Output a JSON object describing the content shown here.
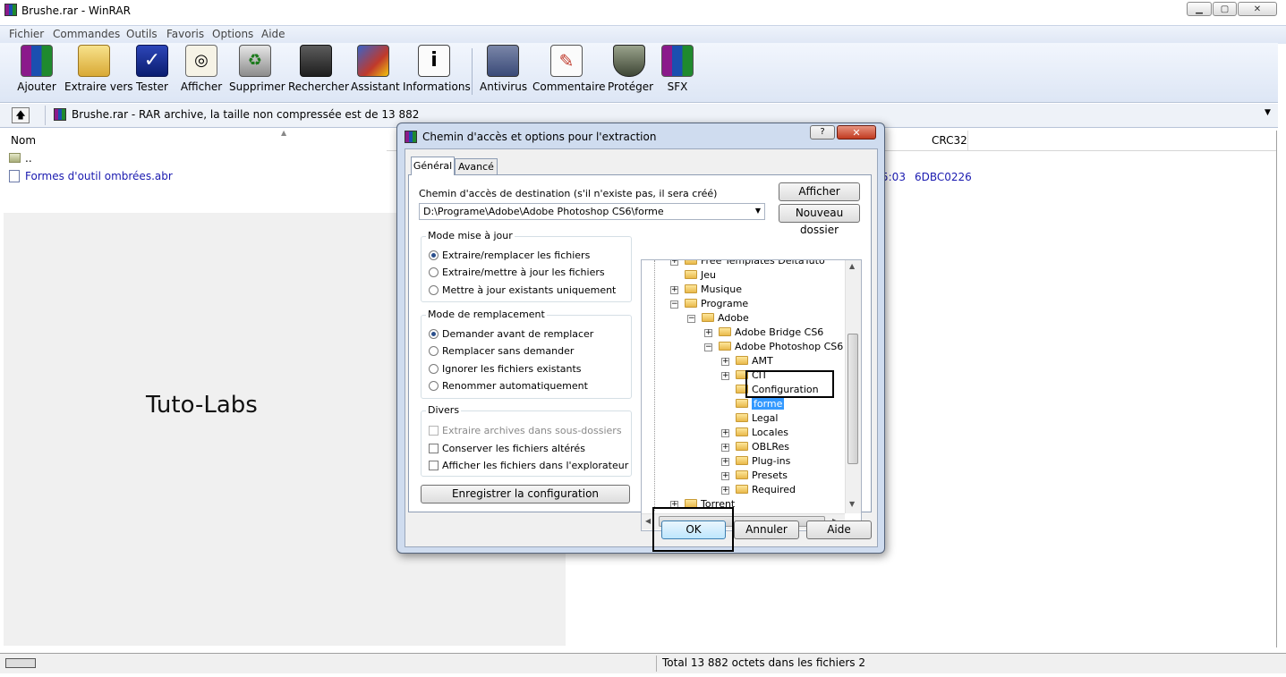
{
  "window": {
    "title": "Brushe.rar - WinRAR",
    "menu": [
      "Fichier",
      "Commandes",
      "Outils",
      "Favoris",
      "Options",
      "Aide"
    ],
    "toolbar": [
      "Ajouter",
      "Extraire vers",
      "Tester",
      "Afficher",
      "Supprimer",
      "Rechercher",
      "Assistant",
      "Informations",
      "Antivirus",
      "Commentaire",
      "Protéger",
      "SFX"
    ],
    "address": "Brushe.rar - RAR archive, la taille non compressée est de 13 882",
    "columns": {
      "name": "Nom",
      "crc": "CRC32"
    },
    "files": [
      {
        "name": "..",
        "time": "",
        "crc": ""
      },
      {
        "name": "Formes d'outil ombrées.abr",
        "time": "5:03",
        "crc": "6DBC0226"
      }
    ],
    "watermark": "Tuto-Labs",
    "status": "Total 13 882 octets dans les fichiers 2"
  },
  "dialog": {
    "title": "Chemin d'accès et options pour l'extraction",
    "help_glyph": "?",
    "close_glyph": "✕",
    "tabs": [
      "Général",
      "Avancé"
    ],
    "dest_label": "Chemin d'accès de destination (s'il n'existe pas, il sera créé)",
    "dest_value": "D:\\Programe\\Adobe\\Adobe Photoshop CS6\\forme",
    "btn_afficher": "Afficher",
    "btn_nouveau": "Nouveau dossier",
    "update_mode": {
      "title": "Mode mise à jour",
      "options": [
        "Extraire/remplacer les fichiers",
        "Extraire/mettre à jour les fichiers",
        "Mettre à jour existants uniquement"
      ],
      "selected": 0
    },
    "replace_mode": {
      "title": "Mode de remplacement",
      "options": [
        "Demander avant de remplacer",
        "Remplacer sans demander",
        "Ignorer les fichiers existants",
        "Renommer automatiquement"
      ],
      "selected": 0
    },
    "misc": {
      "title": "Divers",
      "options": [
        "Extraire archives dans sous-dossiers",
        "Conserver les fichiers altérés",
        "Afficher les fichiers dans l'explorateur"
      ]
    },
    "btn_save": "Enregistrer la configuration",
    "tree": [
      {
        "label": "Free Templates DeltaTuto",
        "level": 0,
        "exp": "+"
      },
      {
        "label": "Jeu",
        "level": 0,
        "exp": ""
      },
      {
        "label": "Musique",
        "level": 0,
        "exp": "+"
      },
      {
        "label": "Programe",
        "level": 0,
        "exp": "-"
      },
      {
        "label": "Adobe",
        "level": 1,
        "exp": "-"
      },
      {
        "label": "Adobe Bridge CS6",
        "level": 2,
        "exp": "+"
      },
      {
        "label": "Adobe Photoshop CS6",
        "level": 2,
        "exp": "-"
      },
      {
        "label": "AMT",
        "level": 3,
        "exp": "+"
      },
      {
        "label": "CIT",
        "level": 3,
        "exp": "+"
      },
      {
        "label": "Configuration",
        "level": 3,
        "exp": ""
      },
      {
        "label": "forme",
        "level": 3,
        "exp": "",
        "selected": true
      },
      {
        "label": "Legal",
        "level": 3,
        "exp": ""
      },
      {
        "label": "Locales",
        "level": 3,
        "exp": "+"
      },
      {
        "label": "OBLRes",
        "level": 3,
        "exp": "+"
      },
      {
        "label": "Plug-ins",
        "level": 3,
        "exp": "+"
      },
      {
        "label": "Presets",
        "level": 3,
        "exp": "+"
      },
      {
        "label": "Required",
        "level": 3,
        "exp": "+"
      },
      {
        "label": "Torrent",
        "level": 0,
        "exp": "+"
      }
    ],
    "btn_ok": "OK",
    "btn_annuler": "Annuler",
    "btn_aide": "Aide"
  }
}
